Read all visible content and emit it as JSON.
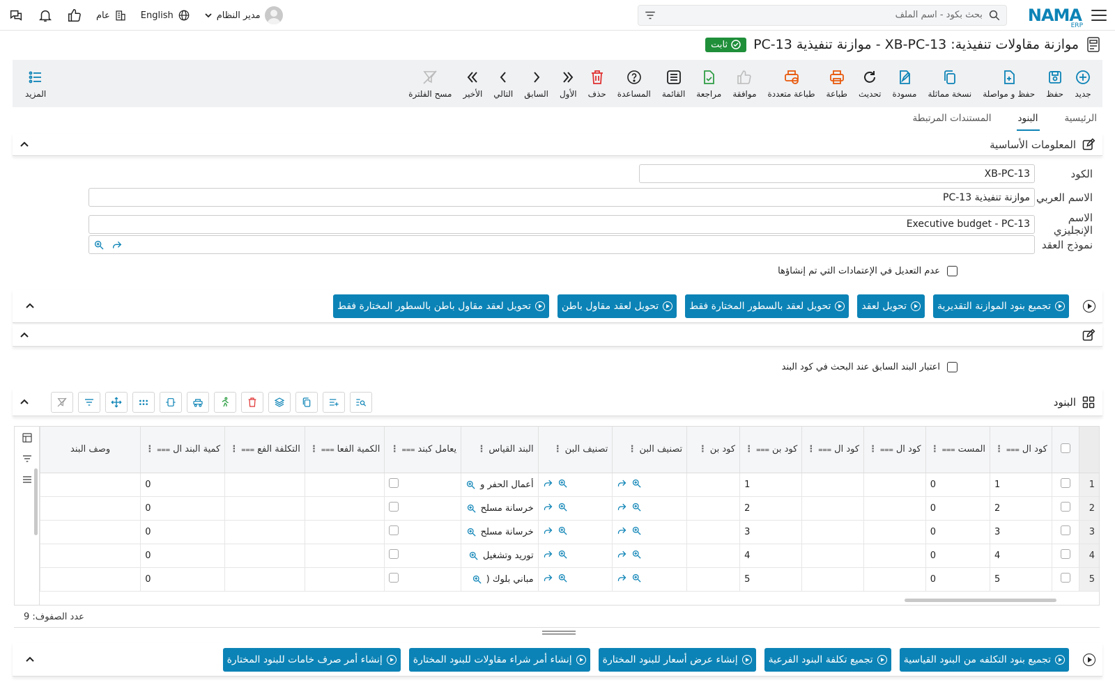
{
  "header": {
    "logo_text": "NAMA",
    "logo_sub": "ERP",
    "search_placeholder": "بحث بكود - اسم الملف",
    "user_name": "مدير النظام",
    "language": "English",
    "scope": "عام"
  },
  "page": {
    "title": "موازنة مقاولات تنفيذية: XB-PC-13 - موازنة تنفيذية PC-13",
    "status": "ثابت"
  },
  "toolbar": {
    "new": "جديد",
    "save": "حفظ",
    "save_continue": "حفظ و مواصلة",
    "duplicate": "نسخة مماثلة",
    "draft": "مسودة",
    "refresh": "تحديث",
    "print": "طباعة",
    "multi_print": "طباعة متعددة",
    "approve": "موافقة",
    "review": "مراجعة",
    "list": "القائمة",
    "help": "المساعدة",
    "delete": "حذف",
    "first": "الأول",
    "previous": "السابق",
    "next": "التالي",
    "last": "الأخير",
    "clear_filter": "مسح الفلترة",
    "more": "المزيد"
  },
  "tabs": [
    "الرئيسية",
    "البنود",
    "المستندات المرتبطة"
  ],
  "basic_section": {
    "title": "المعلومات الأساسية",
    "code_label": "الكود",
    "code_value": "XB-PC-13",
    "arabic_name_label": "الاسم العربي",
    "arabic_name_value": "موازنة تنفيذية PC-13",
    "english_name_label": "الاسم الإنجليزي",
    "english_name_value": "Executive budget - PC-13",
    "contract_template_label": "نموذج العقد",
    "no_edit_label": "عدم التعديل في الإعتمادات التي تم إنشاؤها"
  },
  "actions_top": [
    "تجميع بنود الموازنة التقديرية",
    "تحويل لعقد",
    "تحويل لعقد بالسطور المختارة فقط",
    "تحويل لعقد مقاول باطن",
    "تحويل لعقد مقاول باطن بالسطور المختارة فقط"
  ],
  "prev_item_label": "اعتبار البند السابق عند البحث في كود البند",
  "items_section": {
    "title": "البنود",
    "columns": [
      "كود ال",
      "المست",
      "كود ال",
      "كود ال",
      "كود بن",
      "كود بن",
      "تصنيف البن",
      "تصنيف البن",
      "البند القياس",
      "يعامل كبند",
      "الكمية الفعا",
      "التكلفة الفع",
      "كمية البند ال",
      "وصف البند"
    ],
    "rows": [
      {
        "n": "1",
        "code": "1",
        "level": "0",
        "code2": "1",
        "std": "أعمال الحفر و",
        "qty": "0"
      },
      {
        "n": "2",
        "code": "2",
        "level": "0",
        "code2": "2",
        "std": "خرسانة مسلح",
        "qty": "0"
      },
      {
        "n": "3",
        "code": "3",
        "level": "0",
        "code2": "3",
        "std": "خرسانة مسلح",
        "qty": "0"
      },
      {
        "n": "4",
        "code": "4",
        "level": "0",
        "code2": "4",
        "std": "توريد وتشغيل",
        "qty": "0"
      },
      {
        "n": "5",
        "code": "5",
        "level": "0",
        "code2": "5",
        "std": "مباني بلوك (",
        "qty": "0"
      }
    ],
    "row_count_label": "عدد الصفوف: 9"
  },
  "actions_bottom": [
    "تجميع بنود التكلفه من البنود القياسية",
    "تجميع تكلفة البنود الفرعية",
    "إنشاء عرض أسعار للبنود المختارة",
    "إنشاء أمر شراء مقاولات للبنود المختارة",
    "إنشاء أمر صرف خامات للبنود المختارة"
  ],
  "colors": {
    "accent": "#0c83b6",
    "status": "#1f8f3a",
    "orange": "#e8590c",
    "green": "#2f9e44"
  }
}
